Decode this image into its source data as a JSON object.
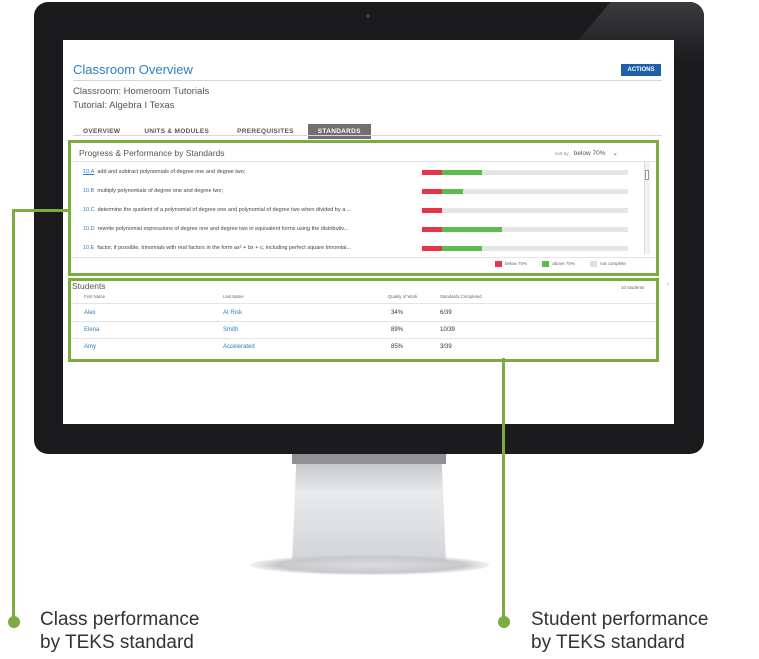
{
  "header": {
    "title": "Classroom Overview",
    "actions_label": "ACTIONS",
    "classroom": "Classroom: Homeroom Tutorials",
    "tutorial": "Tutorial: Algebra I Texas"
  },
  "tabs": [
    {
      "label": "OVERVIEW",
      "active": false
    },
    {
      "label": "UNITS & MODULES",
      "active": false
    },
    {
      "label": "PREREQUISITES",
      "active": false
    },
    {
      "label": "STANDARDS",
      "active": true
    }
  ],
  "standards": {
    "title": "Progress & Performance by Standards",
    "sort_label": "sort by:",
    "sort_value": "below 70%",
    "items": [
      {
        "code": "10.A",
        "text": "add and subtract polynomials of degree one and degree two;",
        "below": 0.097,
        "above": 0.195
      },
      {
        "code": "10.B",
        "text": "multiply polynomials of degree one and degree two;",
        "below": 0.097,
        "above": 0.1
      },
      {
        "code": "10.C",
        "text": "determine the quotient of a polynomial of degree one and polynomial of degree two when divided by a ...",
        "below": 0.097,
        "above": 0.0
      },
      {
        "code": "10.D",
        "text": "rewrite polynomial expressions of degree one and degree two in equivalent forms using the distributiv...",
        "below": 0.097,
        "above": 0.29
      },
      {
        "code": "10.E",
        "text": "factor, if possible, trinomials with real factors in the form ax² + bx + c, including perfect square trinomial...",
        "below": 0.097,
        "above": 0.195
      }
    ],
    "legend": [
      "below 70%",
      "above 70%",
      "not complete"
    ]
  },
  "students": {
    "title": "Students",
    "count_label": "10 students",
    "columns": [
      "First Name",
      "Last Name",
      "Quality of Work",
      "Standards Completed"
    ],
    "rows": [
      {
        "first": "Alex",
        "last": "At Risk",
        "quality": "34%",
        "completed": "6/39"
      },
      {
        "first": "Elena",
        "last": "Smith",
        "quality": "89%",
        "completed": "10/39"
      },
      {
        "first": "Amy",
        "last": "Accelerated",
        "quality": "85%",
        "completed": "3/39"
      }
    ]
  },
  "captions": {
    "left_line1": "Class performance",
    "left_line2": "by TEKS standard",
    "right_line1": "Student performance",
    "right_line2": "by TEKS standard"
  },
  "colors": {
    "accent_green": "#7cab3f",
    "link_blue": "#2f7fc1",
    "below": "#e8334a",
    "above": "#5cbc4c",
    "not_complete": "#e0e0e0"
  }
}
